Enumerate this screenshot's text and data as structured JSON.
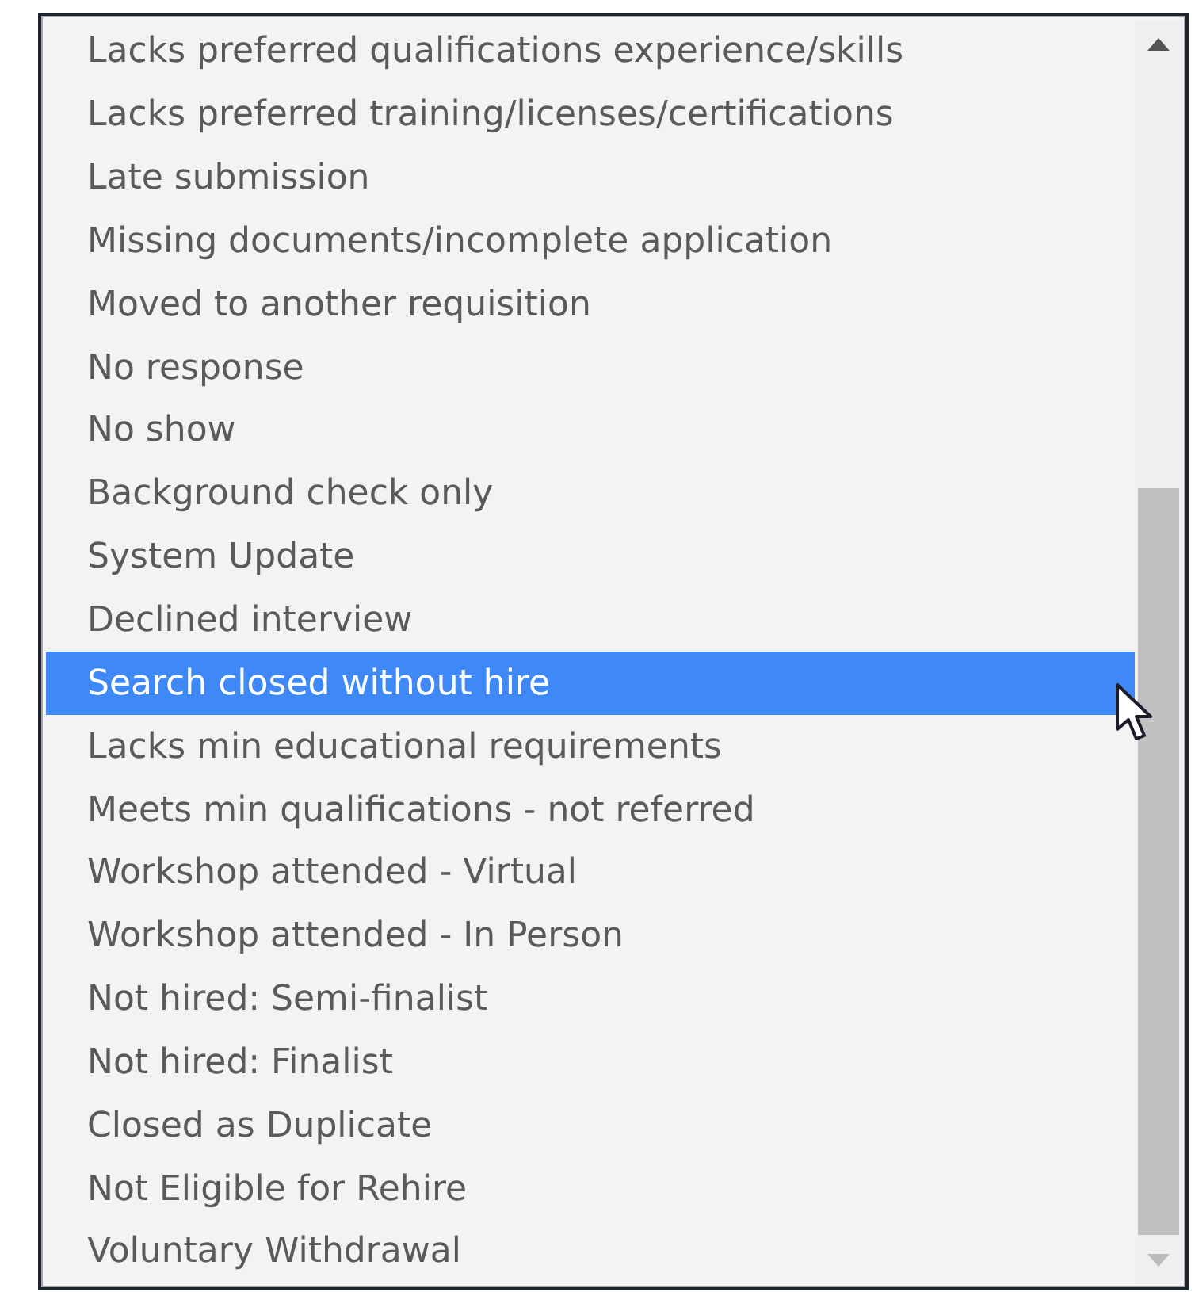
{
  "options": [
    {
      "label": "Lacks preferred qualifications experience/skills",
      "selected": false
    },
    {
      "label": "Lacks preferred training/licenses/certifications",
      "selected": false
    },
    {
      "label": "Late submission",
      "selected": false
    },
    {
      "label": "Missing documents/incomplete application",
      "selected": false
    },
    {
      "label": "Moved to another requisition",
      "selected": false
    },
    {
      "label": "No response",
      "selected": false
    },
    {
      "label": "No show",
      "selected": false
    },
    {
      "label": "Background check only",
      "selected": false
    },
    {
      "label": "System Update",
      "selected": false
    },
    {
      "label": "Declined interview",
      "selected": false
    },
    {
      "label": "Search closed without hire",
      "selected": true
    },
    {
      "label": "Lacks min educational requirements",
      "selected": false
    },
    {
      "label": "Meets min qualifications - not referred",
      "selected": false
    },
    {
      "label": "Workshop attended - Virtual",
      "selected": false
    },
    {
      "label": "Workshop attended - In Person",
      "selected": false
    },
    {
      "label": "Not hired: Semi-finalist",
      "selected": false
    },
    {
      "label": "Not hired: Finalist",
      "selected": false
    },
    {
      "label": "Closed as Duplicate",
      "selected": false
    },
    {
      "label": "Not Eligible for Rehire",
      "selected": false
    },
    {
      "label": "Voluntary Withdrawal",
      "selected": false
    }
  ]
}
